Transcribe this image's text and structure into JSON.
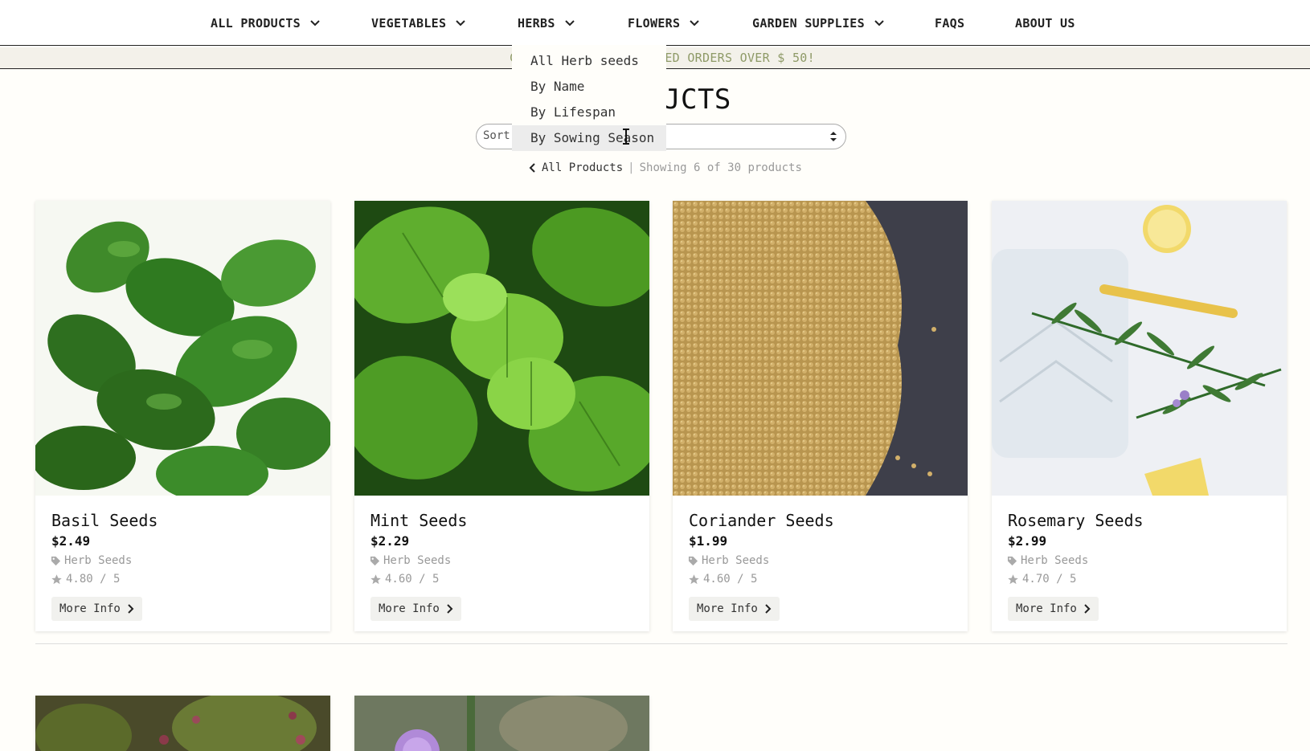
{
  "nav": {
    "items": [
      {
        "label": "ALL PRODUCTS",
        "has_menu": true
      },
      {
        "label": "VEGETABLES",
        "has_menu": true
      },
      {
        "label": "HERBS",
        "has_menu": true
      },
      {
        "label": "FLOWERS",
        "has_menu": true
      },
      {
        "label": "GARDEN SUPPLIES",
        "has_menu": true
      },
      {
        "label": "FAQS",
        "has_menu": false
      },
      {
        "label": "ABOUT US",
        "has_menu": false
      }
    ]
  },
  "banner": {
    "visible_left": "C",
    "visible_right": "EED ORDERS OVER $ 50!"
  },
  "page": {
    "title_visible": "JCTS"
  },
  "sort": {
    "label": "Sort"
  },
  "breadcrumb": {
    "back_label": "All Products",
    "separator": "|",
    "count_text": "Showing 6 of 30 products"
  },
  "herbs_menu": {
    "items": [
      {
        "label": "All Herb seeds"
      },
      {
        "label": "By Name"
      },
      {
        "label": "By Lifespan"
      },
      {
        "label": "By Sowing Season"
      }
    ],
    "hovered_index": 3
  },
  "products": [
    {
      "name": "Basil Seeds",
      "price": "$2.49",
      "category": "Herb Seeds",
      "rating": "4.80 / 5",
      "button": "More Info"
    },
    {
      "name": "Mint Seeds",
      "price": "$2.29",
      "category": "Herb Seeds",
      "rating": "4.60 / 5",
      "button": "More Info"
    },
    {
      "name": "Coriander Seeds",
      "price": "$1.99",
      "category": "Herb Seeds",
      "rating": "4.60 / 5",
      "button": "More Info"
    },
    {
      "name": "Rosemary Seeds",
      "price": "$2.99",
      "category": "Herb Seeds",
      "rating": "4.70 / 5",
      "button": "More Info"
    }
  ],
  "colors": {
    "background": "#fffefa",
    "banner_text": "#8e9a67",
    "muted": "#999999",
    "button_bg": "#f1f1ee"
  },
  "icons": {
    "nav_chevron": "chevron-down-icon",
    "back": "chevron-left-icon",
    "category": "tag-icon",
    "rating": "star-icon",
    "more_info": "chevron-right-icon",
    "sort": "sort-arrows-icon"
  }
}
